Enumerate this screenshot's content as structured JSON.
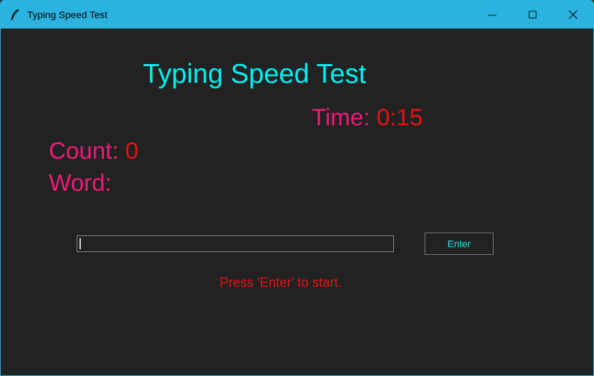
{
  "window": {
    "title": "Typing Speed Test",
    "app_icon": "feather-icon",
    "controls": [
      "minimize-icon",
      "maximize-icon",
      "close-icon"
    ]
  },
  "main": {
    "heading": "Typing Speed Test",
    "time_label": "Time:",
    "time_value": "0:15",
    "count_label": "Count:",
    "count_value": "0",
    "word_label": "Word:",
    "word_value": "",
    "input_value": "",
    "enter_label": "Enter",
    "status": "Press 'Enter' to start."
  },
  "colors": {
    "titlebar": "#2bb3e0",
    "background": "#222222",
    "heading": "#00f0f0",
    "label": "#ef1a78",
    "value": "#e51212",
    "button_text": "#18e8e8"
  }
}
